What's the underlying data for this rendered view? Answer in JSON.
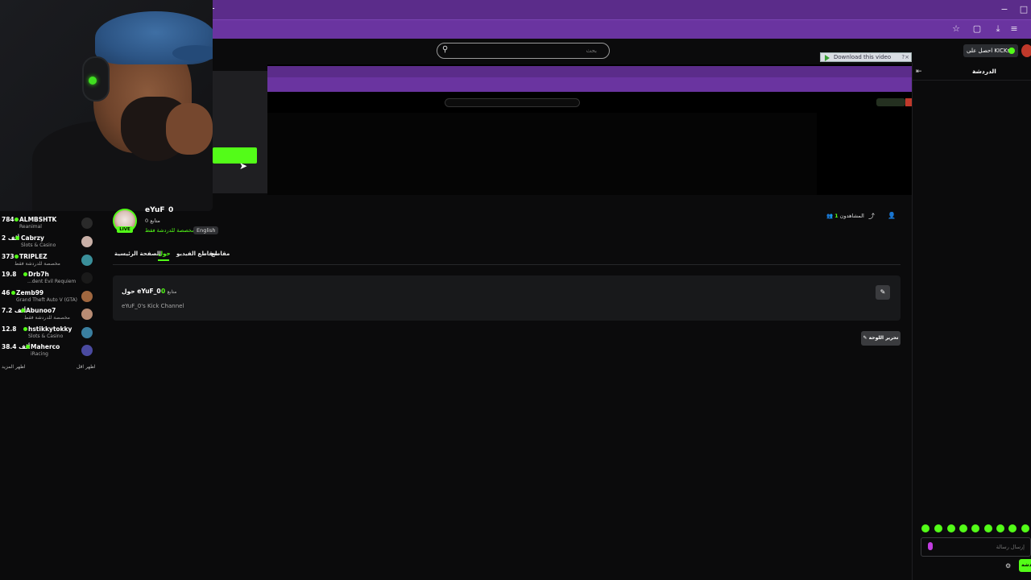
{
  "browser": {
    "toolbar_icons": [
      "star-icon",
      "download-icon",
      "extension-icon",
      "menu-icon"
    ],
    "window_controls": [
      "−",
      "□"
    ]
  },
  "header": {
    "search_placeholder": "بحث",
    "kicks_label": "احصل على KICKs",
    "download_video": "Download this video"
  },
  "sidebar": {
    "channels": [
      {
        "viewers": "784",
        "name": "ALMBSHTK",
        "category": "Reanimal"
      },
      {
        "viewers": "2 ألف",
        "name": "Cabrzy",
        "category": "Slots & Casino"
      },
      {
        "viewers": "373",
        "name": "TRIPLEZ",
        "category": "مخصصة للدردشة فقط"
      },
      {
        "viewers": "19.8",
        "name": "Drb7h",
        "category": "...dent Evil Requiem"
      },
      {
        "viewers": "46",
        "name": "Zemb99",
        "category": "Grand Theft Auto V (GTA)"
      },
      {
        "viewers": "7.2 ألف",
        "name": "Abunoo7",
        "category": "مخصصة للدردشة فقط"
      },
      {
        "viewers": "12.8",
        "name": "hstikkytokky",
        "category": "Slots & Casino"
      },
      {
        "viewers": "38.4 ألف",
        "name": "Maherco",
        "category": "iRacing"
      }
    ],
    "show_more": "اظهر المزيد",
    "show_less": "اظهر اقل"
  },
  "channel": {
    "name": "eYuF_0",
    "followers": "0 متابع",
    "category": "مخصصة للدردشة فقط",
    "language": "English",
    "live_badge": "LIVE",
    "viewers_label": "المشاهدون",
    "viewers_count": "1"
  },
  "tabs": [
    {
      "label": "الصفحة الرئيسية",
      "active": false
    },
    {
      "label": "حول",
      "active": true
    },
    {
      "label": "مقاطع الفيديو",
      "active": false
    },
    {
      "label": "مقاطع",
      "active": false
    }
  ],
  "about": {
    "title": "حول eYuF_0",
    "followers_count": "0",
    "followers_label": "متابع",
    "description": "eYuF_0's Kick Channel",
    "edit_panel": "تحرير اللوحة"
  },
  "chat": {
    "title": "الدردشة",
    "placeholder": "إرسال رسالة",
    "send": "دردشة"
  },
  "colors": {
    "accent": "#53fc18",
    "browser_purple": "#6a34a0",
    "background": "#0b0b0c",
    "card": "#18191b"
  }
}
